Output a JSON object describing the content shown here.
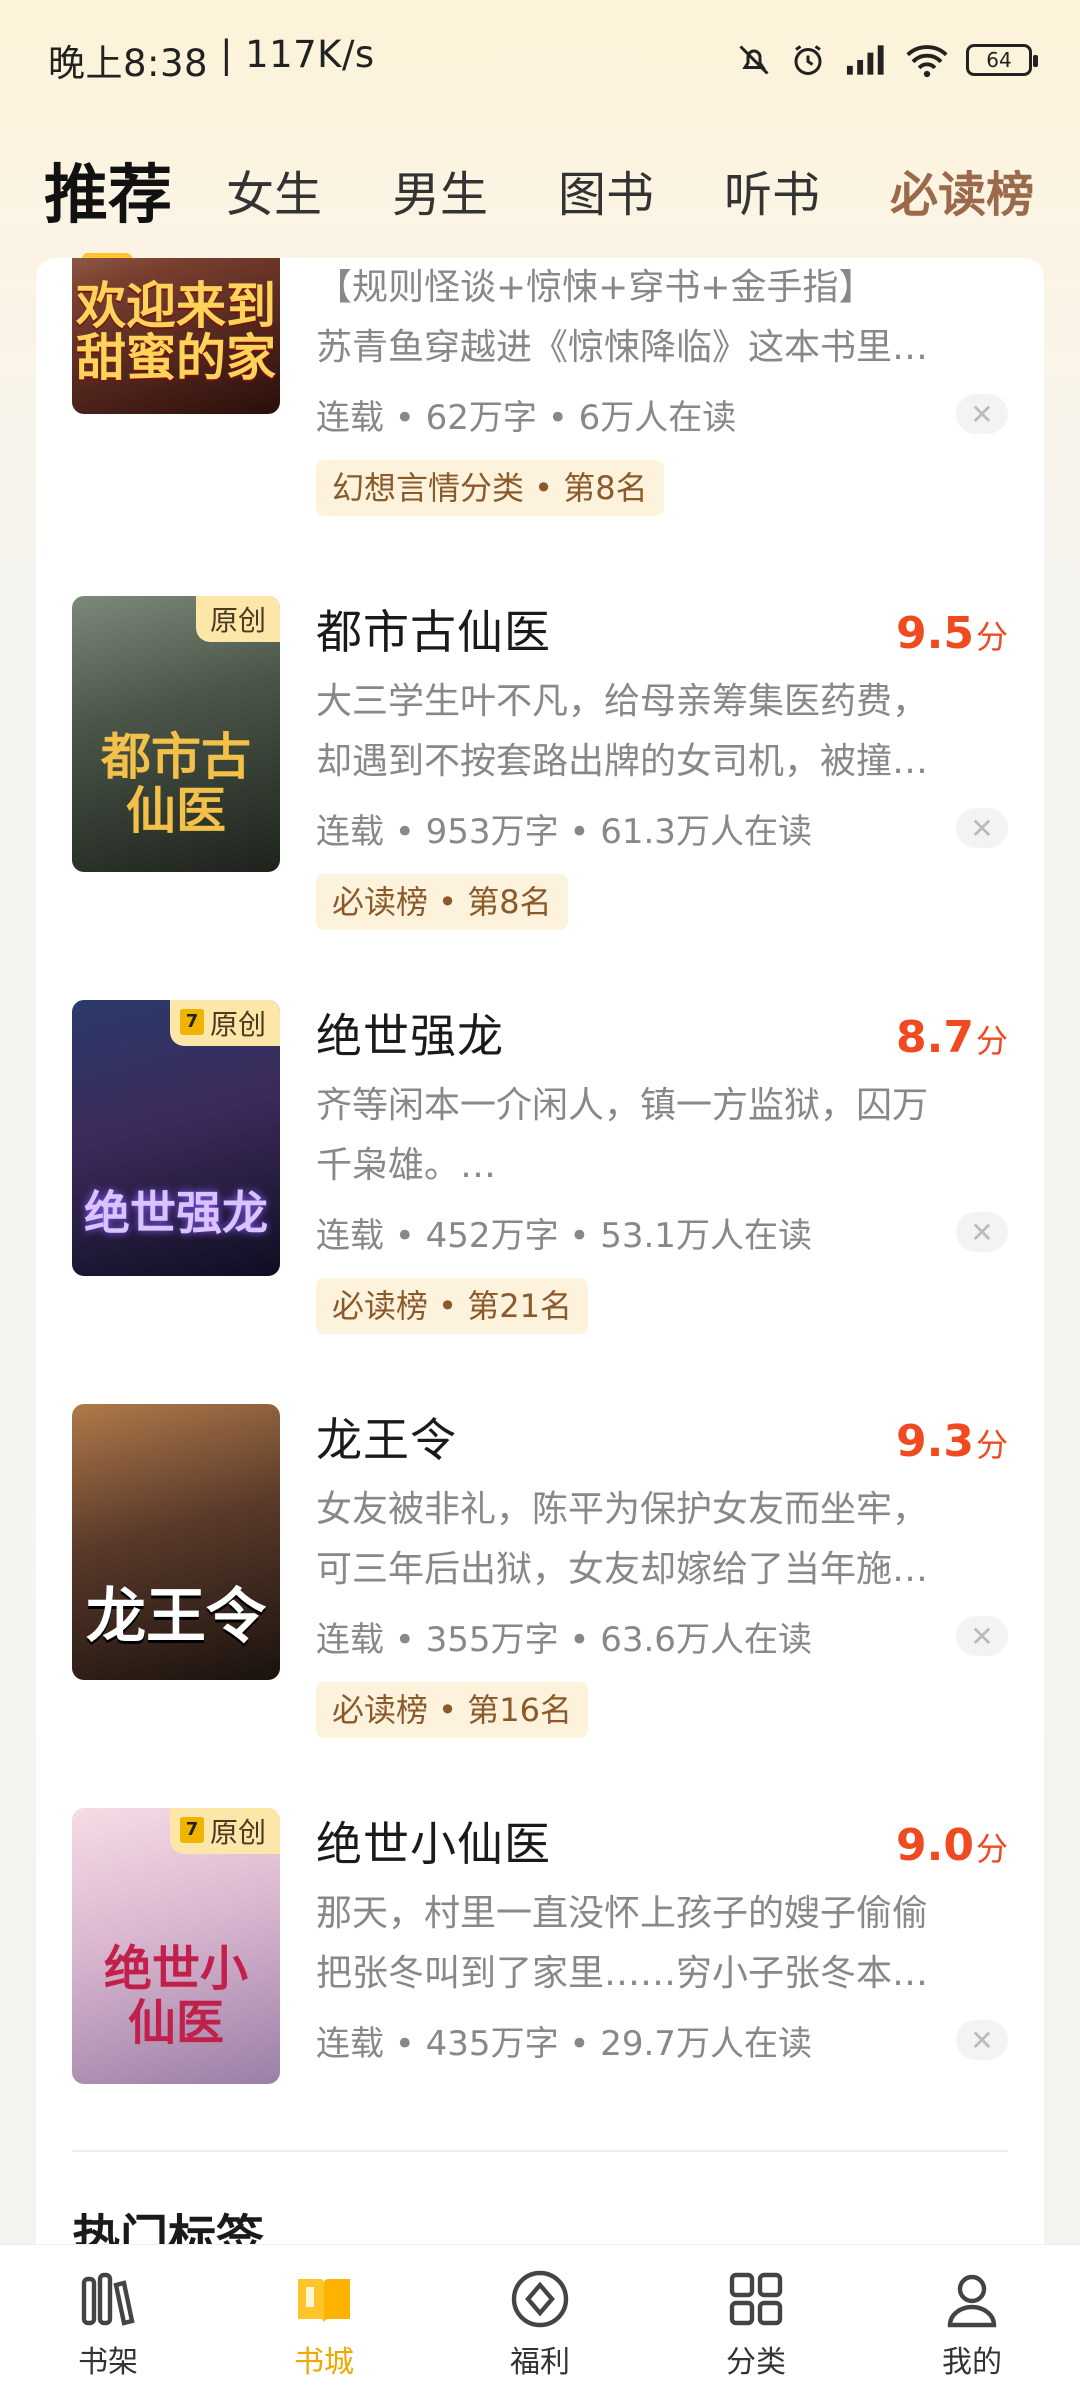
{
  "status_bar": {
    "time": "晚上8:38",
    "speed": "117K/s",
    "battery": "64",
    "icons": [
      "mute-bell-icon",
      "alarm-icon",
      "signal-icon",
      "wifi-icon",
      "battery-icon"
    ]
  },
  "tabs": [
    {
      "label": "推荐",
      "active": true
    },
    {
      "label": "女生"
    },
    {
      "label": "男生"
    },
    {
      "label": "图书"
    },
    {
      "label": "听书"
    },
    {
      "label": "必读榜"
    }
  ],
  "books": [
    {
      "title": "",
      "desc_line1": "【规则怪谈+惊悚+穿书+金手指】",
      "desc_line2": "苏青鱼穿越进《惊悚降临》这本书里…",
      "meta": "连载 • 62万字 • 6万人在读",
      "rank": "幻想言情分类 • 第8名",
      "cover_text": "欢迎来到甜蜜的家",
      "badge": ""
    },
    {
      "title": "都市古仙医",
      "score": "9.5",
      "score_unit": "分",
      "desc_line1": "大三学生叶不凡，给母亲筹集医药费，",
      "desc_line2": "却遇到不按套路出牌的女司机，被撞…",
      "meta": "连载 • 953万字 • 61.3万人在读",
      "rank": "必读榜 • 第8名",
      "cover_text": "都市古仙医",
      "badge": "原创"
    },
    {
      "title": "绝世强龙",
      "score": "8.7",
      "score_unit": "分",
      "desc_line1": "齐等闲本一介闲人，镇一方监狱，囚万",
      "desc_line2": "千枭雄。…",
      "meta": "连载 • 452万字 • 53.1万人在读",
      "rank": "必读榜 • 第21名",
      "cover_text": "绝世强龙",
      "badge": "原创"
    },
    {
      "title": "龙王令",
      "score": "9.3",
      "score_unit": "分",
      "desc_line1": "女友被非礼，陈平为保护女友而坐牢，",
      "desc_line2": "可三年后出狱，女友却嫁给了当年施…",
      "meta": "连载 • 355万字 • 63.6万人在读",
      "rank": "必读榜 • 第16名",
      "cover_text": "龙王令",
      "badge": ""
    },
    {
      "title": "绝世小仙医",
      "score": "9.0",
      "score_unit": "分",
      "desc_line1": "那天，村里一直没怀上孩子的嫂子偷偷",
      "desc_line2": "把张冬叫到了家里……穷小子张冬本…",
      "meta": "连载 • 435万字 • 29.7万人在读",
      "rank": "",
      "cover_text": "绝世小仙医",
      "badge": "原创"
    }
  ],
  "close_label": "✕",
  "section": {
    "title": "热门标签"
  },
  "bottom_nav": [
    {
      "label": "书架",
      "icon": "bookshelf-icon"
    },
    {
      "label": "书城",
      "icon": "book-open-icon",
      "active": true
    },
    {
      "label": "福利",
      "icon": "benefit-icon"
    },
    {
      "label": "分类",
      "icon": "grid-icon"
    },
    {
      "label": "我的",
      "icon": "profile-icon"
    }
  ],
  "colors": {
    "accent": "#ffc52b",
    "score": "#f04a20",
    "rank_bg": "#fdf2dc",
    "rank_text": "#8a5a2b"
  }
}
